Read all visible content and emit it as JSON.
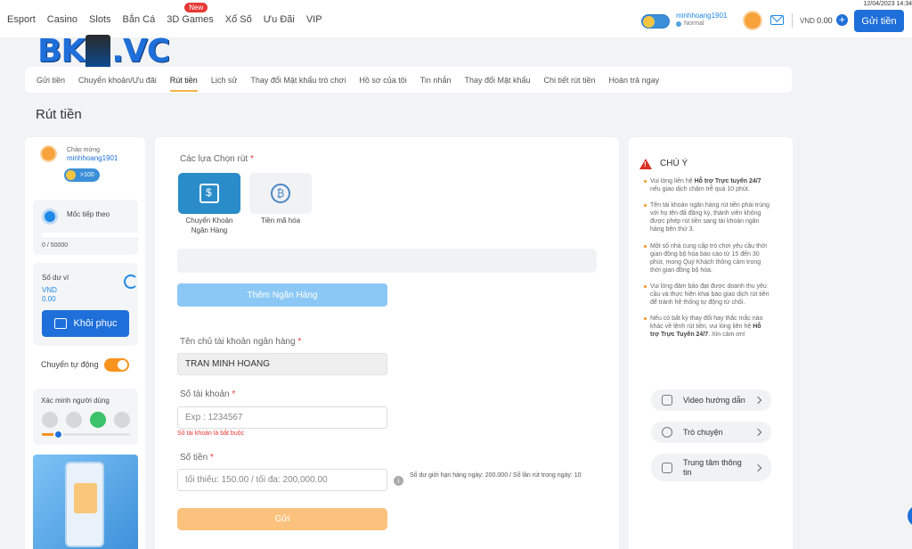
{
  "nav": {
    "items": [
      "Esport",
      "Casino",
      "Slots",
      "Bắn Cá",
      "3D Games",
      "Xổ Số",
      "Ưu Đãi",
      "VIP"
    ],
    "new_badge": "New"
  },
  "datetime": "12/04/2023 14:34",
  "user": {
    "username": "minhhoang1901",
    "level": "Normal"
  },
  "balance": {
    "currency": "VND",
    "amount": "0.00"
  },
  "deposit_button": "Gửi tiền",
  "logo": {
    "left": "BK",
    "right": ".VC"
  },
  "subnav": {
    "items": [
      "Gửi tiền",
      "Chuyển khoản/Ưu đãi",
      "Rút tiền",
      "Lịch sử",
      "Thay đổi Mật khẩu trò chơi",
      "Hồ sơ của tôi",
      "Tin nhắn",
      "Thay đổi Mật khẩu",
      "Chi tiết rút tiền",
      "Hoàn trả ngay"
    ],
    "active": "Rút tiền"
  },
  "page_title": "Rút tiền",
  "profile": {
    "greeting": "Chào mừng",
    "username": "minhhoang1901",
    "vip": ">100"
  },
  "milestone": {
    "label": "Mốc tiếp theo",
    "value": "0 / 50000",
    "progress": 0
  },
  "wallet": {
    "label": "Số dư ví",
    "currency": "VND",
    "amount": "0.00",
    "restore": "Khôi phục"
  },
  "auto_transfer": {
    "label": "Chuyển tự động",
    "on": true
  },
  "verify": {
    "label": "Xác minh người dùng",
    "progress": 0.14
  },
  "withdraw": {
    "options_label": "Các lựa Chọn rút",
    "options": [
      {
        "line1": "Chuyển Khoản",
        "line2": "Ngân Hàng"
      },
      {
        "line1": "Tiền mã hóa"
      }
    ],
    "add_bank": "Thêm Ngân Hàng",
    "holder_label": "Tên chủ tài khoản ngân hàng",
    "holder_value": "TRAN MINH HOANG",
    "account_label": "Số tài khoản",
    "account_placeholder": "Exp : 1234567",
    "account_error": "Số tài khoản là bắt buộc",
    "amount_label": "Số tiền",
    "amount_placeholder": "tối thiểu: 150.00 / tối đa: 200,000.00",
    "limit_text": "Số dư giới hạn hàng ngày: 200.000 / Số lần rút trong ngày: 10",
    "submit": "Gửi",
    "required_mark": "*"
  },
  "notice": {
    "title": "CHÚ Ý",
    "items": [
      {
        "pre": "Vui lòng liên hệ ",
        "bold": "Hỗ trợ Trực tuyến 24/7",
        "post": " nếu giao dịch chậm trễ quá 10 phút."
      },
      {
        "pre": "Tên tài khoản ngân hàng rút tiền phải trùng với họ tên đã đăng ký, thành viên không được phép rút tiền sang tài khoản ngân hàng bên thứ 3.",
        "bold": "",
        "post": ""
      },
      {
        "pre": "Một số nhà cung cấp trò chơi yêu cầu thời gian đồng bộ hóa báo cáo từ 15 đến 30 phút, mong Quý Khách thông cảm trong thời gian đồng bộ hóa.",
        "bold": "",
        "post": ""
      },
      {
        "pre": "Vui lòng đảm bảo đạt được doanh thu yêu cầu và thực hiện khai báo giao dịch rút tiền để tránh hệ thống tự động từ chối.",
        "bold": "",
        "post": ""
      },
      {
        "pre": "Nếu có bất kỳ thay đổi hay thắc mắc nào khác về lệnh rút tiền, vui lòng liên hệ ",
        "bold": "Hỗ trợ Trực Tuyến 24/7",
        "post": ". Xin cảm ơn!"
      }
    ]
  },
  "help_links": [
    "Video hướng dẫn",
    "Trò chuyện",
    "Trung tâm thông tin"
  ],
  "colors": {
    "primary": "#1e6fd9",
    "accent": "#f7931e",
    "error": "#e53935"
  }
}
